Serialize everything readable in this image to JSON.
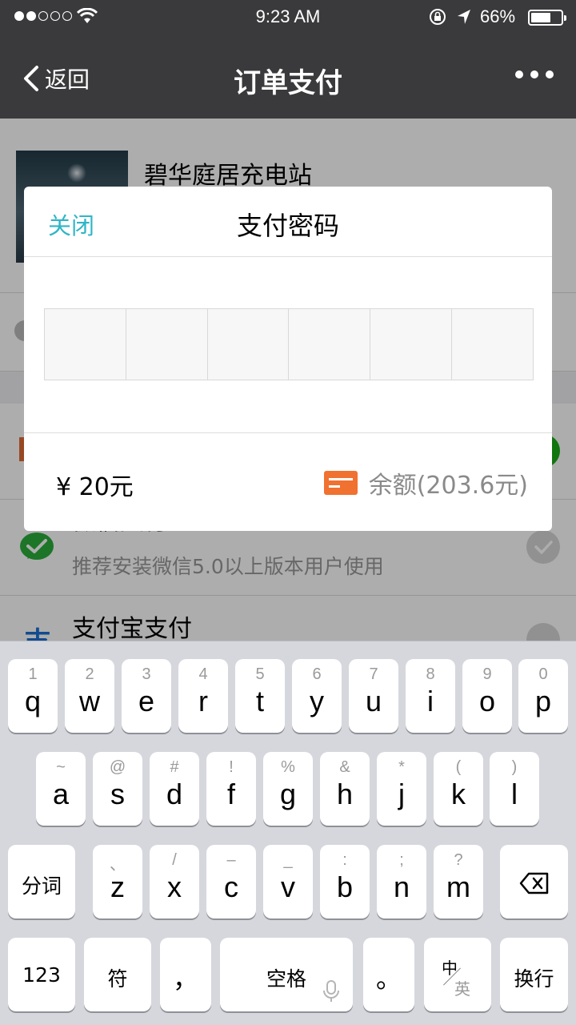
{
  "status_bar": {
    "time": "9:23 AM",
    "battery_text": "66%",
    "battery_level": 0.66,
    "signal_bars_filled": 2,
    "signal_bars_total": 5
  },
  "nav": {
    "back_label": "返回",
    "title": "订单支付"
  },
  "page": {
    "merchant_name": "碧华庭居充电站",
    "methods": [
      {
        "title": "微信支付",
        "subtitle": "推荐安装微信5.0以上版本用户使用",
        "icon": "wechat-pay-icon"
      },
      {
        "title": "支付宝支付",
        "icon": "alipay-icon"
      }
    ]
  },
  "dialog": {
    "close_label": "关闭",
    "title": "支付密码",
    "digits_count": 6,
    "amount": "¥ 20元",
    "balance": "余额(203.6元)",
    "card_color": "#f07130"
  },
  "keyboard": {
    "row1": [
      {
        "hint": "1",
        "ch": "q"
      },
      {
        "hint": "2",
        "ch": "w"
      },
      {
        "hint": "3",
        "ch": "e"
      },
      {
        "hint": "4",
        "ch": "r"
      },
      {
        "hint": "5",
        "ch": "t"
      },
      {
        "hint": "6",
        "ch": "y"
      },
      {
        "hint": "7",
        "ch": "u"
      },
      {
        "hint": "8",
        "ch": "i"
      },
      {
        "hint": "9",
        "ch": "o"
      },
      {
        "hint": "0",
        "ch": "p"
      }
    ],
    "row2": [
      {
        "hint": "~",
        "ch": "a"
      },
      {
        "hint": "@",
        "ch": "s"
      },
      {
        "hint": "#",
        "ch": "d"
      },
      {
        "hint": "!",
        "ch": "f"
      },
      {
        "hint": "%",
        "ch": "g"
      },
      {
        "hint": "&",
        "ch": "h"
      },
      {
        "hint": "*",
        "ch": "j"
      },
      {
        "hint": "(",
        "ch": "k"
      },
      {
        "hint": ")",
        "ch": "l"
      }
    ],
    "row3": [
      {
        "hint": "、",
        "ch": "z"
      },
      {
        "hint": "/",
        "ch": "x"
      },
      {
        "hint": "–",
        "ch": "c"
      },
      {
        "hint": "_",
        "ch": "v"
      },
      {
        "hint": ":",
        "ch": "b"
      },
      {
        "hint": ";",
        "ch": "n"
      },
      {
        "hint": "?",
        "ch": "m"
      }
    ],
    "segment_label": "分词",
    "numbers_label": "123",
    "symbols_label": "符",
    "comma_label": "，",
    "space_label": "空格",
    "period_label": "。",
    "lang_zh": "中",
    "lang_en": "英",
    "return_label": "换行"
  }
}
